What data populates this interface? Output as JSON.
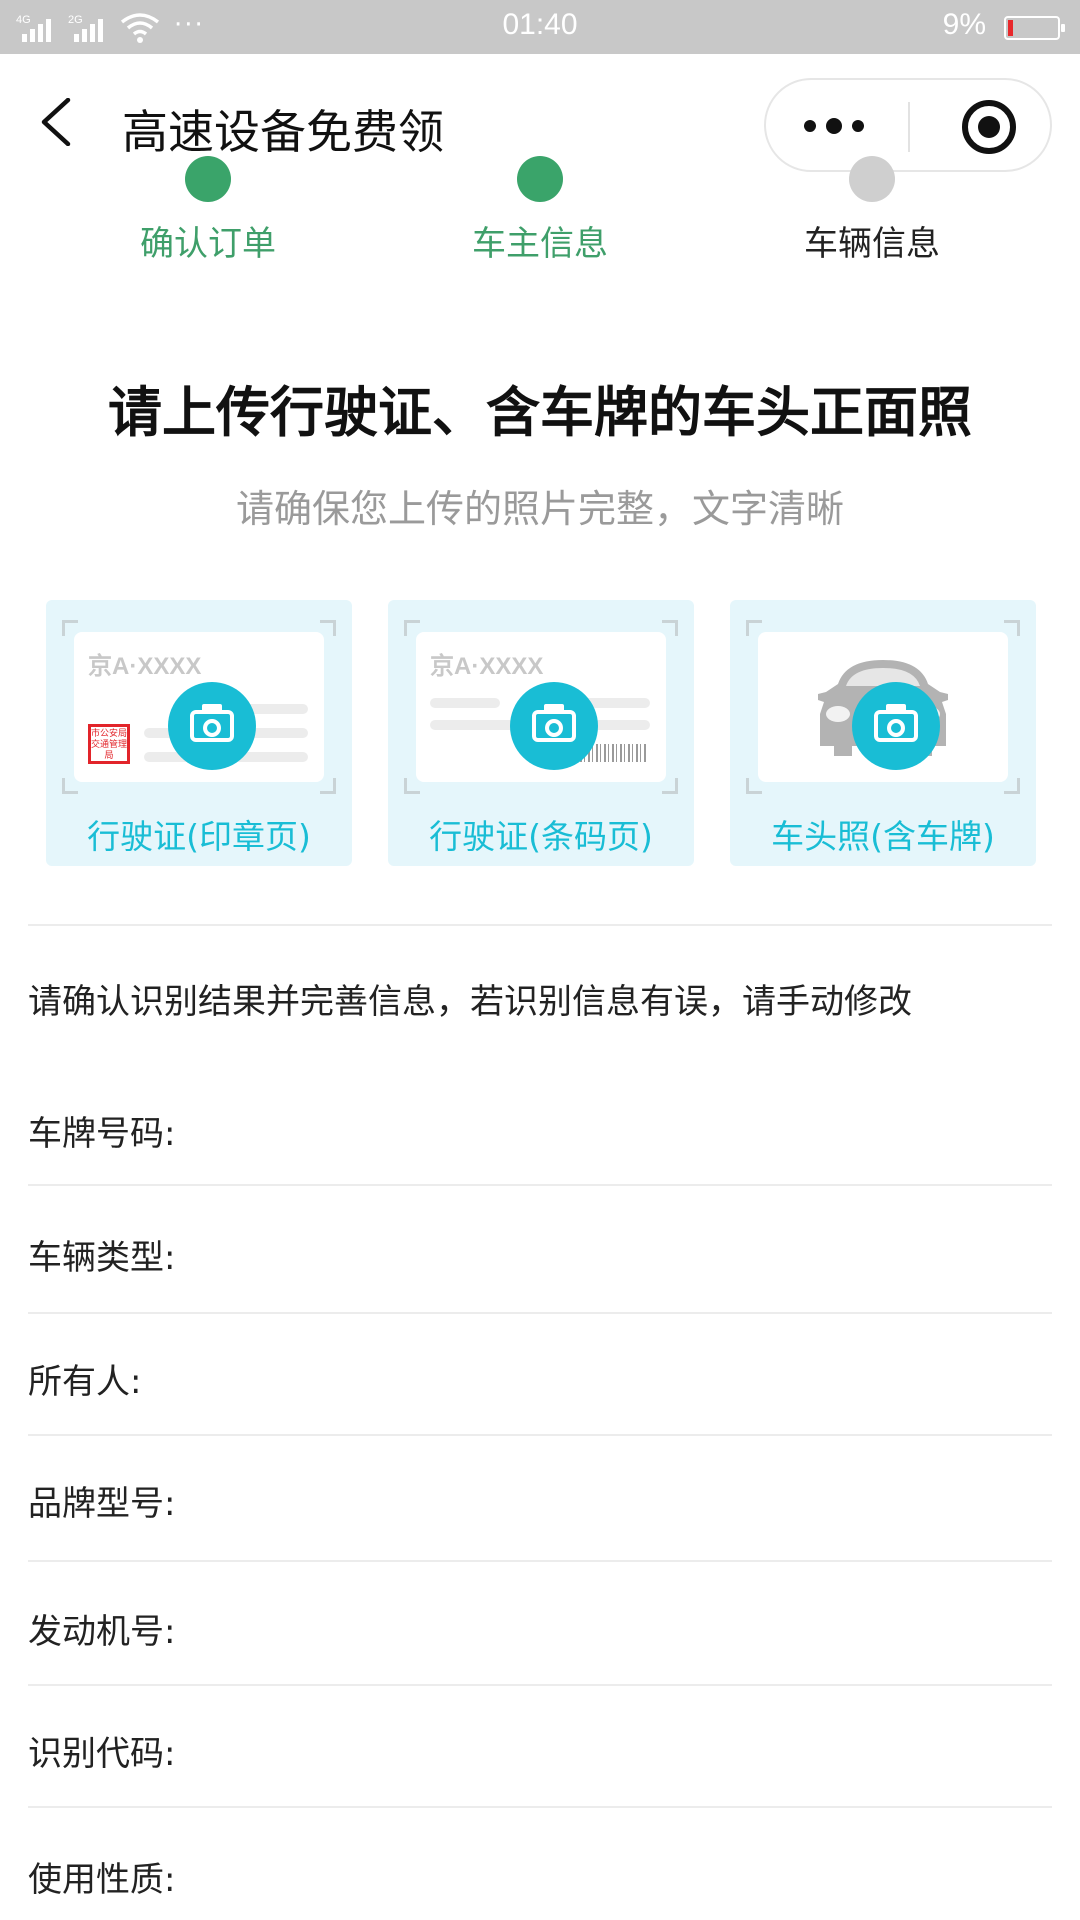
{
  "status_bar": {
    "net1": "4G",
    "net2": "2G",
    "time": "01:40",
    "battery": "9%",
    "more": "···"
  },
  "nav": {
    "title": "高速设备免费领"
  },
  "steps": [
    {
      "label": "确认订单",
      "state": "done"
    },
    {
      "label": "车主信息",
      "state": "done"
    },
    {
      "label": "车辆信息",
      "state": "todo"
    }
  ],
  "heading": {
    "title": "请上传行驶证、含车牌的车头正面照",
    "subtitle": "请确保您上传的照片完整，文字清晰"
  },
  "upload_cards": [
    {
      "label": "行驶证(印章页)",
      "plate": "京A·XXXX",
      "stamp": "市公安局交通管理局"
    },
    {
      "label": "行驶证(条码页)",
      "plate": "京A·XXXX"
    },
    {
      "label": "车头照(含车牌)"
    }
  ],
  "info": {
    "hint": "请确认识别结果并完善信息，若识别信息有误，请手动修改",
    "fields": [
      {
        "label": "车牌号码:"
      },
      {
        "label": "车辆类型:"
      },
      {
        "label": "所有人:"
      },
      {
        "label": "品牌型号:"
      },
      {
        "label": "发动机号:"
      },
      {
        "label": "识别代码:"
      },
      {
        "label": "使用性质:"
      }
    ]
  },
  "colors": {
    "accent": "#19bdd5",
    "step_done": "#3aa46a",
    "card_bg": "#e5f6fb"
  }
}
